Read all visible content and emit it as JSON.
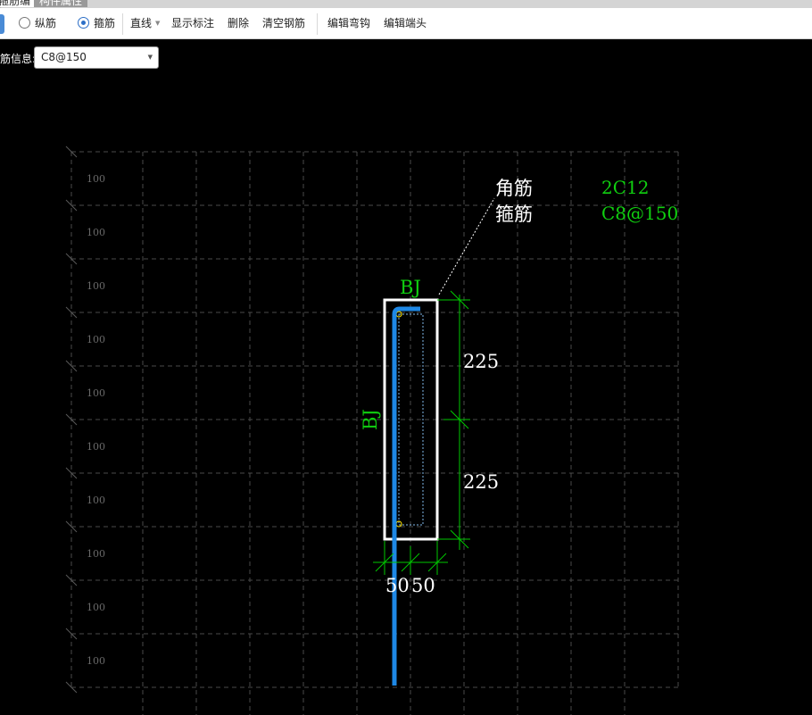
{
  "tabs": {
    "active": "箍筋编辑",
    "other": "构件属性"
  },
  "toolbar": {
    "radio_longitudinal": "纵筋",
    "radio_stirrup": "箍筋",
    "line_label": "直线",
    "show_dimensions": "显示标注",
    "delete_label": "删除",
    "clear_rebar": "清空钢筋",
    "edit_hook": "编辑弯钩",
    "edit_end": "编辑端头"
  },
  "rebar_info": {
    "label": "筋信息:",
    "value": "C8@150"
  },
  "drawing": {
    "grid_labels": [
      "100",
      "100",
      "100",
      "100",
      "100",
      "100",
      "100",
      "100",
      "100",
      "100"
    ],
    "legend": {
      "corner_label": "角筋",
      "corner_value": "2C12",
      "stirrup_label": "箍筋",
      "stirrup_value": "C8@150"
    },
    "side_label_top": "BJ",
    "side_label_left": "BJ",
    "dim_upper": "225",
    "dim_lower": "225",
    "dim_bottom_left": "50",
    "dim_bottom_right": "50",
    "colors": {
      "background": "#000000",
      "grid": "#4a4a4a",
      "outline": "#ffffff",
      "dimension": "#00c800",
      "stirrup": "#1e88e5",
      "label": "#ffffff",
      "legend_value": "#10d010"
    }
  }
}
